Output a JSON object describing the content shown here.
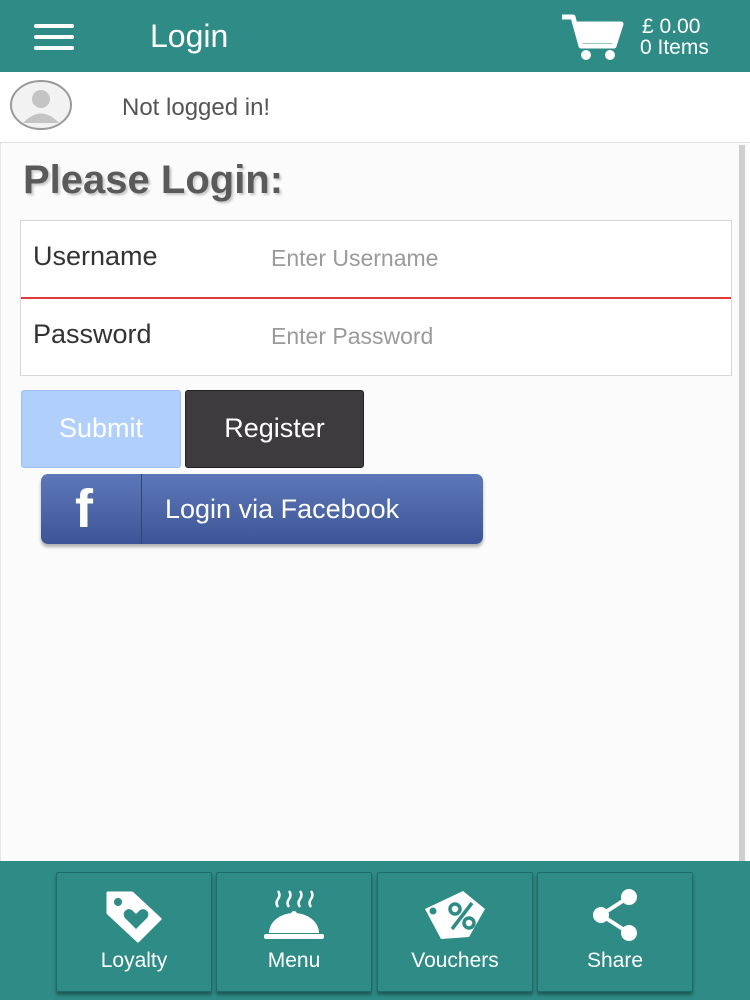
{
  "header": {
    "title": "Login",
    "cart": {
      "total": "£ 0.00",
      "items": "0 Items"
    }
  },
  "user": {
    "status": "Not logged in!"
  },
  "login": {
    "heading": "Please Login:",
    "username_label": "Username",
    "username_placeholder": "Enter Username",
    "password_label": "Password",
    "password_placeholder": "Enter Password",
    "submit_label": "Submit",
    "register_label": "Register",
    "facebook_label": "Login via Facebook",
    "facebook_glyph": "f"
  },
  "bottom_nav": [
    {
      "label": "Loyalty",
      "icon": "tag-heart-icon"
    },
    {
      "label": "Menu",
      "icon": "cloche-icon"
    },
    {
      "label": "Vouchers",
      "icon": "percent-tag-icon"
    },
    {
      "label": "Share",
      "icon": "share-icon"
    }
  ],
  "colors": {
    "primary": "#2f8b86",
    "submit": "#b0cffb",
    "register": "#3d3b3e",
    "facebook": "#3c5596",
    "input_focus": "#e23a3a"
  }
}
